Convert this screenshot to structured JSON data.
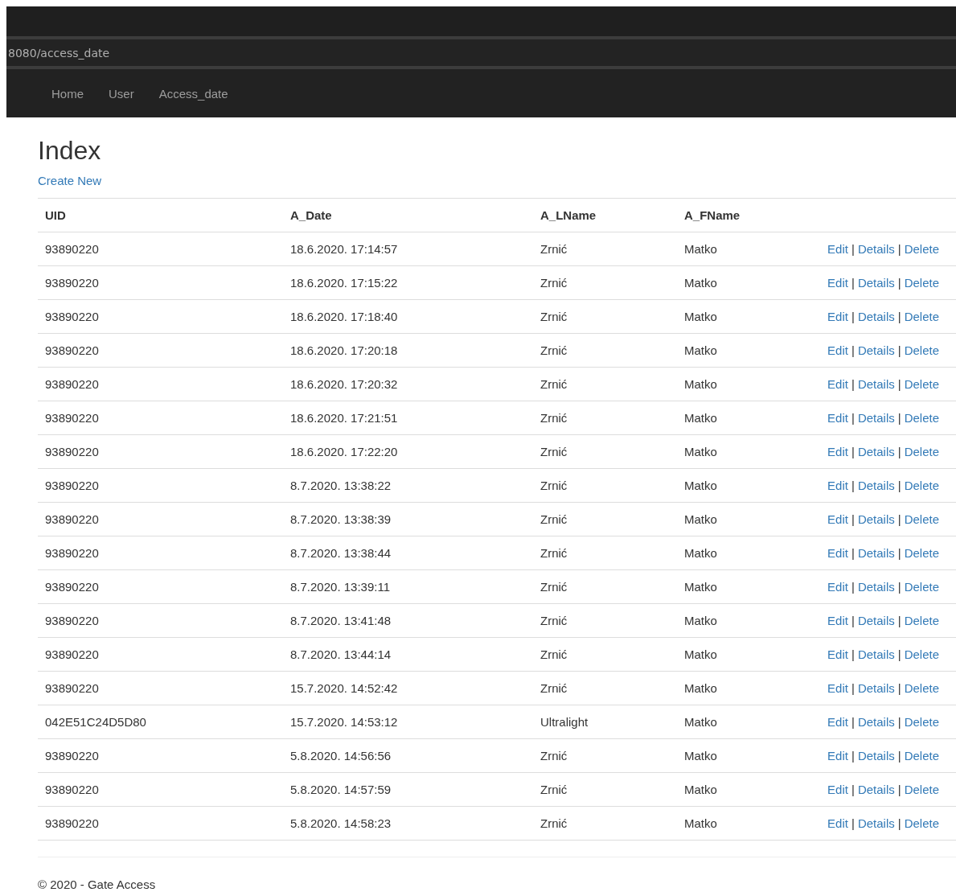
{
  "browser": {
    "address": "8080/access_date"
  },
  "nav": {
    "items": [
      {
        "label": "Home"
      },
      {
        "label": "User"
      },
      {
        "label": "Access_date"
      }
    ]
  },
  "page": {
    "title": "Index",
    "create_link": "Create New"
  },
  "table": {
    "columns": [
      "UID",
      "A_Date",
      "A_LName",
      "A_FName"
    ],
    "rows": [
      {
        "cells": [
          "93890220",
          "18.6.2020. 17:14:57",
          "Zrnić",
          "Matko"
        ],
        "actions": [
          "Edit",
          "|",
          "Details",
          "|",
          "Delete"
        ]
      },
      {
        "cells": [
          "93890220",
          "18.6.2020. 17:15:22",
          "Zrnić",
          "Matko"
        ],
        "actions": [
          "Edit",
          "|",
          "Details",
          "|",
          "Delete"
        ]
      },
      {
        "cells": [
          "93890220",
          "18.6.2020. 17:18:40",
          "Zrnić",
          "Matko"
        ],
        "actions": [
          "Edit",
          "|",
          "Details",
          "|",
          "Delete"
        ]
      },
      {
        "cells": [
          "93890220",
          "18.6.2020. 17:20:18",
          "Zrnić",
          "Matko"
        ],
        "actions": [
          "Edit",
          "|",
          "Details",
          "|",
          "Delete"
        ]
      },
      {
        "cells": [
          "93890220",
          "18.6.2020. 17:20:32",
          "Zrnić",
          "Matko"
        ],
        "actions": [
          "Edit",
          "|",
          "Details",
          "|",
          "Delete"
        ]
      },
      {
        "cells": [
          "93890220",
          "18.6.2020. 17:21:51",
          "Zrnić",
          "Matko"
        ],
        "actions": [
          "Edit",
          "|",
          "Details",
          "|",
          "Delete"
        ]
      },
      {
        "cells": [
          "93890220",
          "18.6.2020. 17:22:20",
          "Zrnić",
          "Matko"
        ],
        "actions": [
          "Edit",
          "|",
          "Details",
          "|",
          "Delete"
        ]
      },
      {
        "cells": [
          "93890220",
          "8.7.2020. 13:38:22",
          "Zrnić",
          "Matko"
        ],
        "actions": [
          "Edit",
          "|",
          "Details",
          "|",
          "Delete"
        ]
      },
      {
        "cells": [
          "93890220",
          "8.7.2020. 13:38:39",
          "Zrnić",
          "Matko"
        ],
        "actions": [
          "Edit",
          "|",
          "Details",
          "|",
          "Delete"
        ]
      },
      {
        "cells": [
          "93890220",
          "8.7.2020. 13:38:44",
          "Zrnić",
          "Matko"
        ],
        "actions": [
          "Edit",
          "|",
          "Details",
          "|",
          "Delete"
        ]
      },
      {
        "cells": [
          "93890220",
          "8.7.2020. 13:39:11",
          "Zrnić",
          "Matko"
        ],
        "actions": [
          "Edit",
          "|",
          "Details",
          "|",
          "Delete"
        ]
      },
      {
        "cells": [
          "93890220",
          "8.7.2020. 13:41:48",
          "Zrnić",
          "Matko"
        ],
        "actions": [
          "Edit",
          "|",
          "Details",
          "|",
          "Delete"
        ]
      },
      {
        "cells": [
          "93890220",
          "8.7.2020. 13:44:14",
          "Zrnić",
          "Matko"
        ],
        "actions": [
          "Edit",
          "|",
          "Details",
          "|",
          "Delete"
        ]
      },
      {
        "cells": [
          "93890220",
          "15.7.2020. 14:52:42",
          "Zrnić",
          "Matko"
        ],
        "actions": [
          "Edit",
          "|",
          "Details",
          "|",
          "Delete"
        ]
      },
      {
        "cells": [
          "042E51C24D5D80",
          "15.7.2020. 14:53:12",
          "Ultralight",
          "Matko"
        ],
        "actions": [
          "Edit",
          "|",
          "Details",
          "|",
          "Delete"
        ]
      },
      {
        "cells": [
          "93890220",
          "5.8.2020. 14:56:56",
          "Zrnić",
          "Matko"
        ],
        "actions": [
          "Edit",
          "|",
          "Details",
          "|",
          "Delete"
        ]
      },
      {
        "cells": [
          "93890220",
          "5.8.2020. 14:57:59",
          "Zrnić",
          "Matko"
        ],
        "actions": [
          "Edit",
          "|",
          "Details",
          "|",
          "Delete"
        ]
      },
      {
        "cells": [
          "93890220",
          "5.8.2020. 14:58:23",
          "Zrnić",
          "Matko"
        ],
        "actions": [
          "Edit",
          "|",
          "Details",
          "|",
          "Delete"
        ]
      }
    ]
  },
  "footer": {
    "text": "© 2020 - Gate Access"
  }
}
